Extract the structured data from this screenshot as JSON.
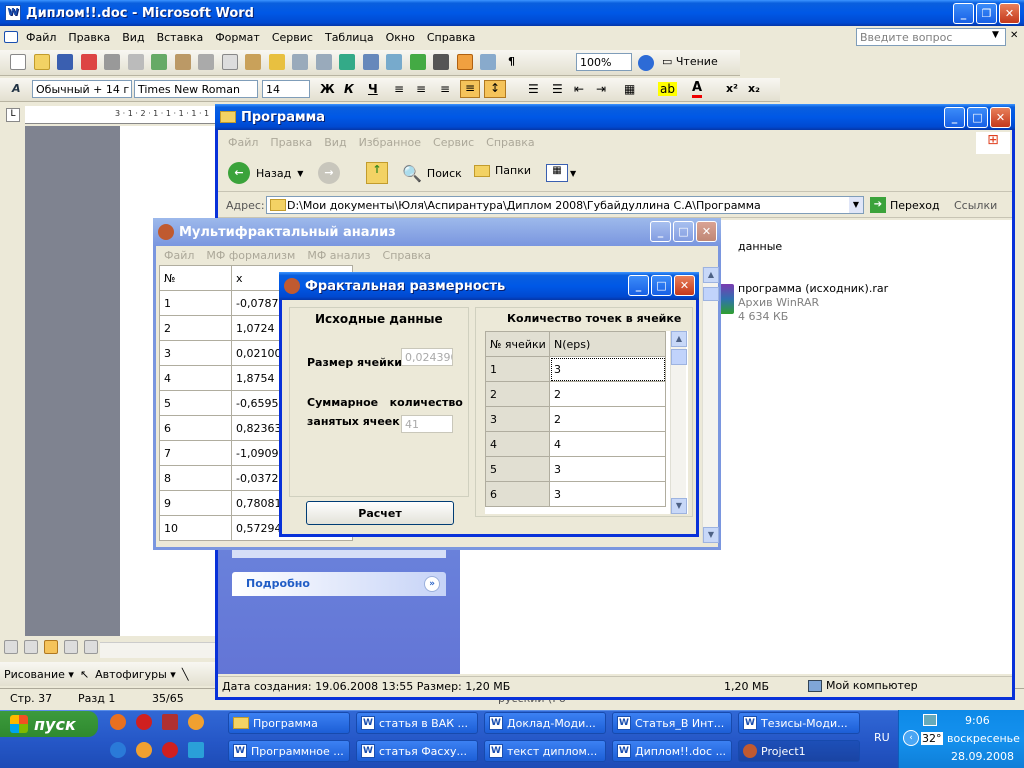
{
  "word": {
    "title": "Диплом!!.doc - Microsoft Word",
    "menu": [
      "Файл",
      "Правка",
      "Вид",
      "Вставка",
      "Формат",
      "Сервис",
      "Таблица",
      "Окно",
      "Справка"
    ],
    "help_placeholder": "Введите вопрос",
    "zoom": "100%",
    "reading": "Чтение",
    "style": "Обычный + 14 г",
    "font": "Times New Roman",
    "font_size": "14",
    "format_buttons": [
      "Ж",
      "К",
      "Ч"
    ],
    "status": {
      "page": "Стр. 37",
      "section": "Разд 1",
      "pages": "35/65",
      "lang": "русский (Ро"
    },
    "draw_label": "Рисование",
    "autoshapes": "Автофигуры",
    "ruler_text": "3 · 1 · 2 · 1 · 1 · 1 · 1 · 1"
  },
  "explorer": {
    "title": "Программа",
    "menu": [
      "Файл",
      "Правка",
      "Вид",
      "Избранное",
      "Сервис",
      "Справка"
    ],
    "back": "Назад",
    "search": "Поиск",
    "folders": "Папки",
    "address_label": "Адрес:",
    "address": "D:\\Мои документы\\Юля\\Аспирантура\\Диплом 2008\\Губайдуллина С.А\\Программа",
    "go": "Переход",
    "links": "Ссылки",
    "side_title": "Подробно",
    "file1": {
      "name": "данные"
    },
    "file2": {
      "name": "программа (исходник).rar",
      "type": "Архив WinRAR",
      "size": "4 634 КБ"
    },
    "status_left": "Дата создания: 19.06.2008 13:55 Размер: 1,20 МБ",
    "status_size": "1,20 МБ",
    "status_location": "Мой компьютер"
  },
  "mf": {
    "title": "Мультифрактальный анализ",
    "menu": [
      "Файл",
      "МФ формализм",
      "МФ анализ",
      "Справка"
    ],
    "headers": [
      "№",
      "x"
    ],
    "rows": [
      [
        "1",
        "-0,0787"
      ],
      [
        "2",
        "1,0724"
      ],
      [
        "3",
        "0,021009"
      ],
      [
        "4",
        "1,8754"
      ],
      [
        "5",
        "-0,65957"
      ],
      [
        "6",
        "0,82363"
      ],
      [
        "7",
        "-1,0909"
      ],
      [
        "8",
        "-0,03727"
      ],
      [
        "9",
        "0,78081"
      ],
      [
        "10",
        "0,57294"
      ]
    ]
  },
  "fd": {
    "title": "Фрактальная размерность",
    "source_title": "Исходные данные",
    "cell_size_label": "Размер ячейки",
    "cell_size_value": "0,024390",
    "total_label1": "Суммарное   количество",
    "total_label2": "занятых ячеек",
    "total_value": "41",
    "calc_button": "Расчет",
    "count_title": "Количество точек в ячейке",
    "headers": [
      "№ ячейки",
      "N(eps)"
    ],
    "rows": [
      [
        "1",
        "3"
      ],
      [
        "2",
        "2"
      ],
      [
        "3",
        "2"
      ],
      [
        "4",
        "4"
      ],
      [
        "5",
        "3"
      ],
      [
        "6",
        "3"
      ]
    ]
  },
  "taskbar": {
    "start": "пуск",
    "row1": [
      "Программа",
      "статья в ВАК ...",
      "Доклад-Моди...",
      "Статья_В Инт...",
      "Тезисы-Моди..."
    ],
    "row2": [
      "Программное ...",
      "статья Фасху...",
      "текст диплом...",
      "Диплом!!.doc ...",
      "Project1"
    ],
    "lang": "RU",
    "temp": "32°",
    "time": "9:06",
    "day": "воскресенье",
    "date": "28.09.2008"
  }
}
